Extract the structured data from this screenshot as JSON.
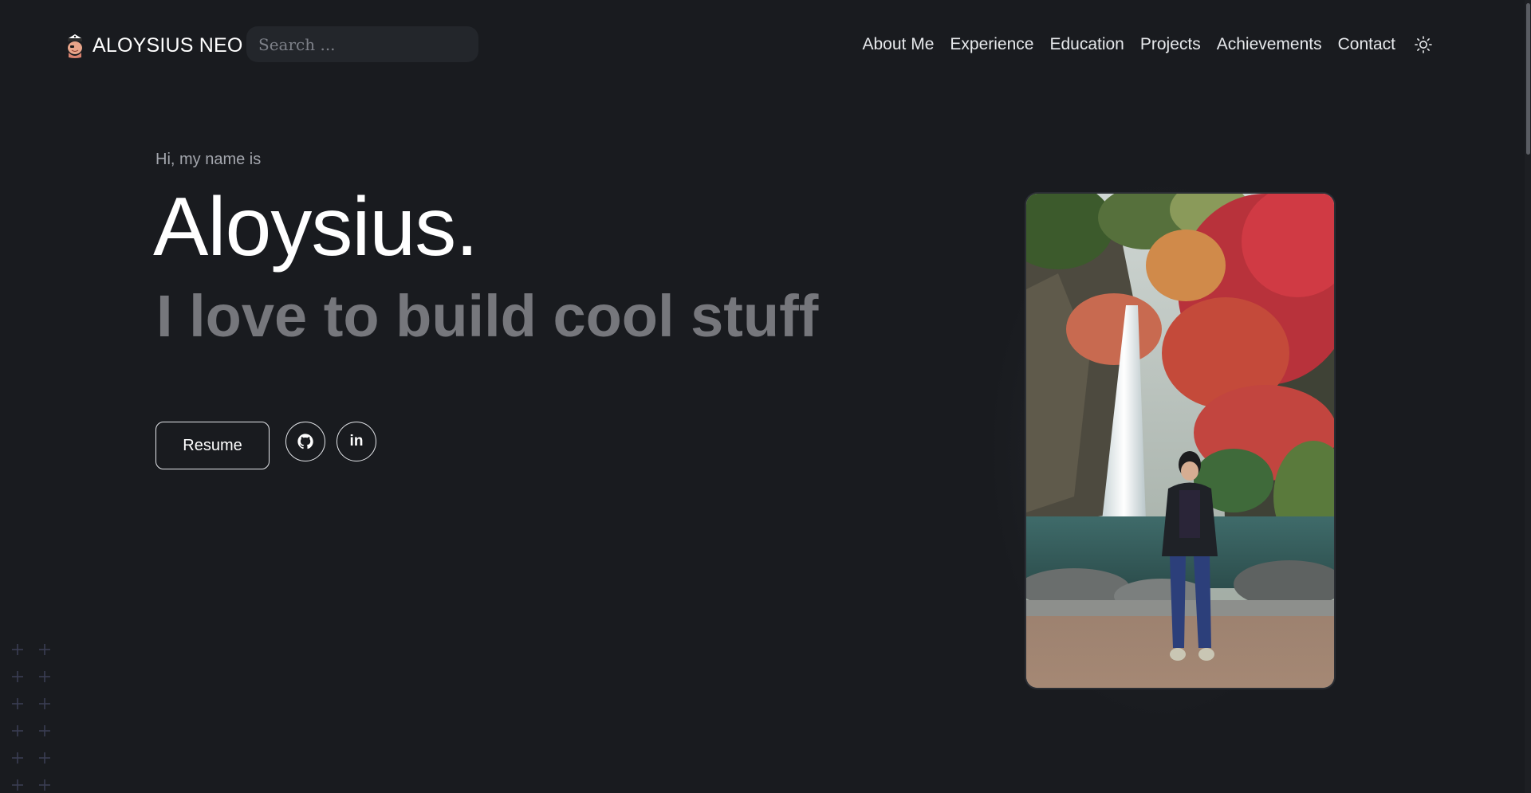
{
  "header": {
    "brand_name": "ALOYSIUS NEO",
    "avatar_icon": "pirate-avatar-icon",
    "search": {
      "placeholder": "Search ...",
      "value": ""
    },
    "nav": [
      {
        "label": "About Me"
      },
      {
        "label": "Experience"
      },
      {
        "label": "Education"
      },
      {
        "label": "Projects"
      },
      {
        "label": "Achievements"
      },
      {
        "label": "Contact"
      }
    ],
    "theme_toggle_icon": "sun-icon"
  },
  "hero": {
    "greeting": "Hi, my name is",
    "name": "Aloysius.",
    "tagline": "I love to build cool stuff",
    "resume_label": "Resume",
    "socials": [
      {
        "icon": "github-icon"
      },
      {
        "icon": "linkedin-icon",
        "glyph": "in"
      }
    ]
  },
  "colors": {
    "background": "#191b1f",
    "text_primary": "#ffffff",
    "text_muted": "#76777c",
    "search_bg": "#23262b",
    "border": "#e5e7eb"
  }
}
